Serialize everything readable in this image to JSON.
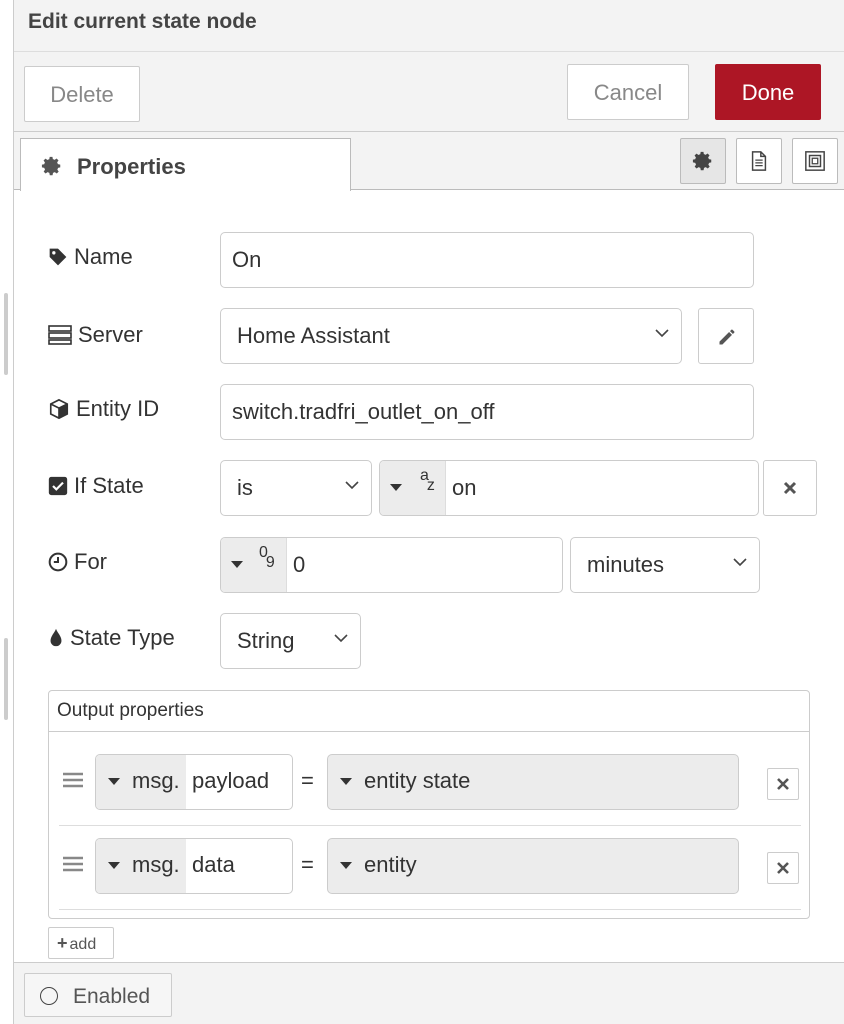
{
  "dialog": {
    "title": "Edit current state node"
  },
  "toolbar": {
    "delete_label": "Delete",
    "cancel_label": "Cancel",
    "done_label": "Done"
  },
  "tabs": {
    "properties_label": "Properties"
  },
  "form": {
    "name": {
      "label": "Name",
      "value": "On"
    },
    "server": {
      "label": "Server",
      "value": "Home Assistant"
    },
    "entity_id": {
      "label": "Entity ID",
      "value": "switch.tradfri_outlet_on_off"
    },
    "if_state": {
      "label": "If State",
      "operator": "is",
      "type_glyph_top": "a",
      "type_glyph_bottom": "z",
      "value": "on"
    },
    "for": {
      "label": "For",
      "type_glyph_top": "0",
      "type_glyph_bottom": "9",
      "value": "0",
      "unit": "minutes"
    },
    "state_type": {
      "label": "State Type",
      "value": "String"
    }
  },
  "output_properties": {
    "title": "Output properties",
    "rows": [
      {
        "prefix": "msg.",
        "property": "payload",
        "equals": "=",
        "source": "entity state"
      },
      {
        "prefix": "msg.",
        "property": "data",
        "equals": "=",
        "source": "entity"
      }
    ],
    "add_label": "add"
  },
  "footer": {
    "enabled_label": "Enabled"
  },
  "colors": {
    "done_button": "#ad1625",
    "panel_bg": "#f3f3f3",
    "border": "#cccccc"
  }
}
